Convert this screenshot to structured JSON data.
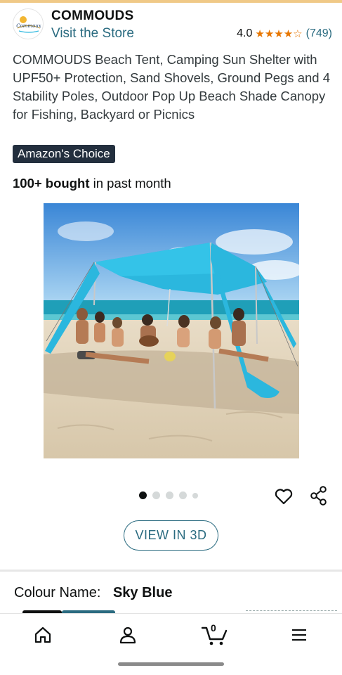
{
  "store": {
    "name": "COMMOUDS",
    "link_label": "Visit the Store",
    "logo_text": "Commoux",
    "rating_value": "4.0",
    "stars": "★★★★☆",
    "rating_count": "(749)"
  },
  "product": {
    "title": "COMMOUDS Beach Tent, Camping Sun Shelter with UPF50+ Protection, Sand Shovels, Ground Pegs and 4 Stability Poles, Outdoor Pop Up Beach Shade Canopy for Fishing, Backyard or Picnics",
    "badge": "Amazon's Choice",
    "bought_bold": "100+ bought",
    "bought_rest": " in past month"
  },
  "gallery": {
    "image_count": 5,
    "active_index": 0,
    "view3d_label": "VIEW IN 3D"
  },
  "variation": {
    "label": "Colour Name:",
    "value": "Sky Blue"
  },
  "nav": {
    "cart_count": "0",
    "items": [
      "home-icon",
      "account-icon",
      "cart-icon",
      "menu-icon"
    ]
  },
  "colors": {
    "link": "#2a6b80",
    "star": "#e77600",
    "badge_bg": "#232f3e",
    "canopy": "#2bb7de"
  }
}
